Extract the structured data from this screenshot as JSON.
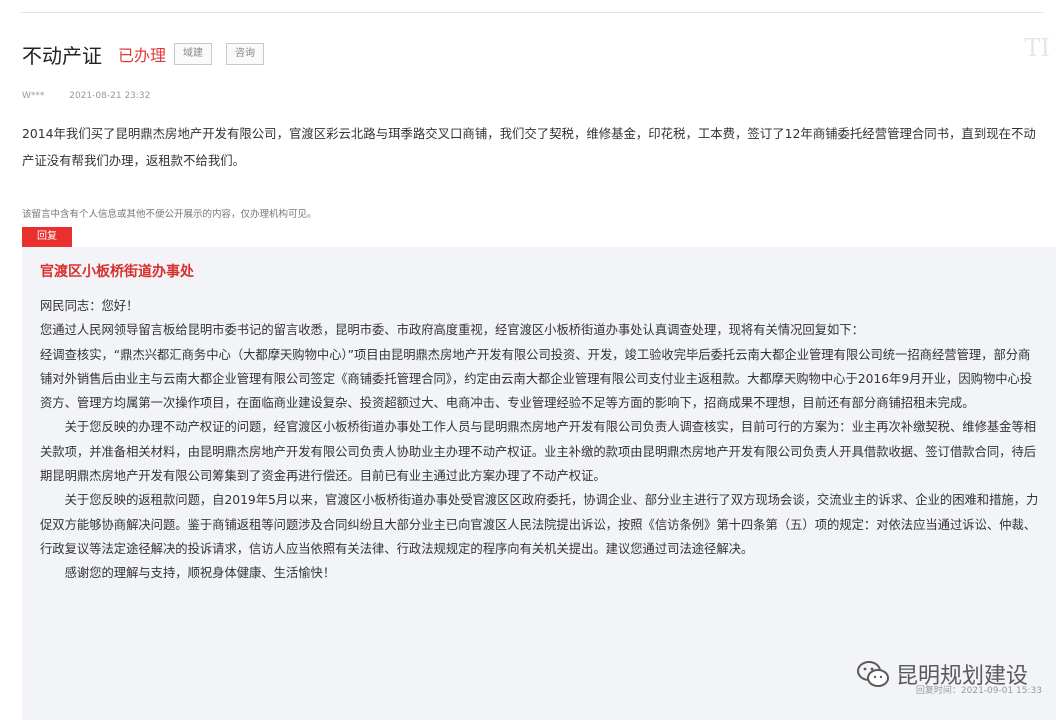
{
  "header": {
    "title": "不动产证",
    "status": "已办理",
    "buttons": [
      "域建",
      "咨询"
    ],
    "faded_mark": "TI"
  },
  "meta": {
    "user": "W***",
    "date": "2021-08-21 23:32"
  },
  "question": "2014年我们买了昆明鼎杰房地产开发有限公司，官渡区彩云北路与珥季路交叉口商铺，我们交了契税，维修基金，印花税，工本费，签订了12年商铺委托经营管理合同书，直到现在不动产证没有帮我们办理，返租款不给我们。",
  "privacy_notice": "该留言中含有个人信息或其他不便公开展示的内容，仅办理机构可见。",
  "reply": {
    "tag": "回复",
    "org": "官渡区小板桥街道办事处",
    "paragraphs": [
      "网民同志：您好！",
      "您通过人民网领导留言板给昆明市委书记的留言收悉，昆明市委、市政府高度重视，经官渡区小板桥街道办事处认真调查处理，现将有关情况回复如下：",
      "经调查核实，“鼎杰兴都汇商务中心（大都摩天购物中心）”项目由昆明鼎杰房地产开发有限公司投资、开发，竣工验收完毕后委托云南大都企业管理有限公司统一招商经营管理，部分商铺对外销售后由业主与云南大都企业管理有限公司签定《商铺委托管理合同》，约定由云南大都企业管理有限公司支付业主返租款。大都摩天购物中心于2016年9月开业，因购物中心投资方、管理方均属第一次操作项目，在面临商业建设复杂、投资超额过大、电商冲击、专业管理经验不足等方面的影响下，招商成果不理想，目前还有部分商铺招租未完成。",
      "关于您反映的办理不动产权证的问题，经官渡区小板桥街道办事处工作人员与昆明鼎杰房地产开发有限公司负责人调查核实，目前可行的方案为：业主再次补缴契税、维修基金等相关款项，并准备相关材料，由昆明鼎杰房地产开发有限公司负责人协助业主办理不动产权证。业主补缴的款项由昆明鼎杰房地产开发有限公司负责人开具借款收据、签订借款合同，待后期昆明鼎杰房地产开发有限公司筹集到了资金再进行偿还。目前已有业主通过此方案办理了不动产权证。",
      "关于您反映的返租款问题，自2019年5月以来，官渡区小板桥街道办事处受官渡区区政府委托，协调企业、部分业主进行了双方现场会谈，交流业主的诉求、企业的困难和措施，力促双方能够协商解决问题。鉴于商铺返租等问题涉及合同纠纷且大部分业主已向官渡区人民法院提出诉讼，按照《信访条例》第十四条第（五）项的规定：对依法应当通过诉讼、仲裁、行政复议等法定途径解决的投诉请求，信访人应当依照有关法律、行政法规规定的程序向有关机关提出。建议您通过司法途径解决。",
      "感谢您的理解与支持，顺祝身体健康、生活愉快！"
    ],
    "time": "回复时间：2021-09-01 15:33"
  },
  "watermark": "昆明规划建设"
}
